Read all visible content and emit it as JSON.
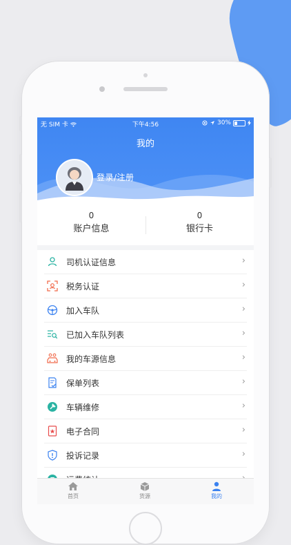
{
  "status": {
    "carrier": "无 SIM 卡",
    "time": "下午4:56",
    "battery": "30%"
  },
  "header": {
    "title": "我的",
    "login": "登录/注册"
  },
  "stats": [
    {
      "value": "0",
      "label": "账户信息"
    },
    {
      "value": "0",
      "label": "银行卡"
    }
  ],
  "menu": [
    {
      "label": "司机认证信息",
      "icon": "user-outline-icon",
      "color": "#2bb3a3"
    },
    {
      "label": "税务认证",
      "icon": "face-scan-icon",
      "color": "#f06a4b"
    },
    {
      "label": "加入车队",
      "icon": "steering-wheel-icon",
      "color": "#3b82f0"
    },
    {
      "label": "已加入车队列表",
      "icon": "list-search-icon",
      "color": "#2bb3a3"
    },
    {
      "label": "我的车源信息",
      "icon": "car-people-icon",
      "color": "#f06a4b"
    },
    {
      "label": "保单列表",
      "icon": "document-check-icon",
      "color": "#3b82f0"
    },
    {
      "label": "车辆维修",
      "icon": "wrench-icon",
      "color": "#2bb3a3"
    },
    {
      "label": "电子合同",
      "icon": "contract-stamp-icon",
      "color": "#e84c4c"
    },
    {
      "label": "投诉记录",
      "icon": "shield-alert-icon",
      "color": "#3b82f0"
    },
    {
      "label": "运费统计",
      "icon": "stats-icon",
      "color": "#2bb3a3"
    }
  ],
  "tabs": [
    {
      "label": "首页",
      "icon": "home-icon"
    },
    {
      "label": "货源",
      "icon": "cargo-box-icon"
    },
    {
      "label": "我的",
      "icon": "profile-icon"
    }
  ],
  "colors": {
    "accent": "#3b82f0",
    "header": "#4d91f6"
  }
}
